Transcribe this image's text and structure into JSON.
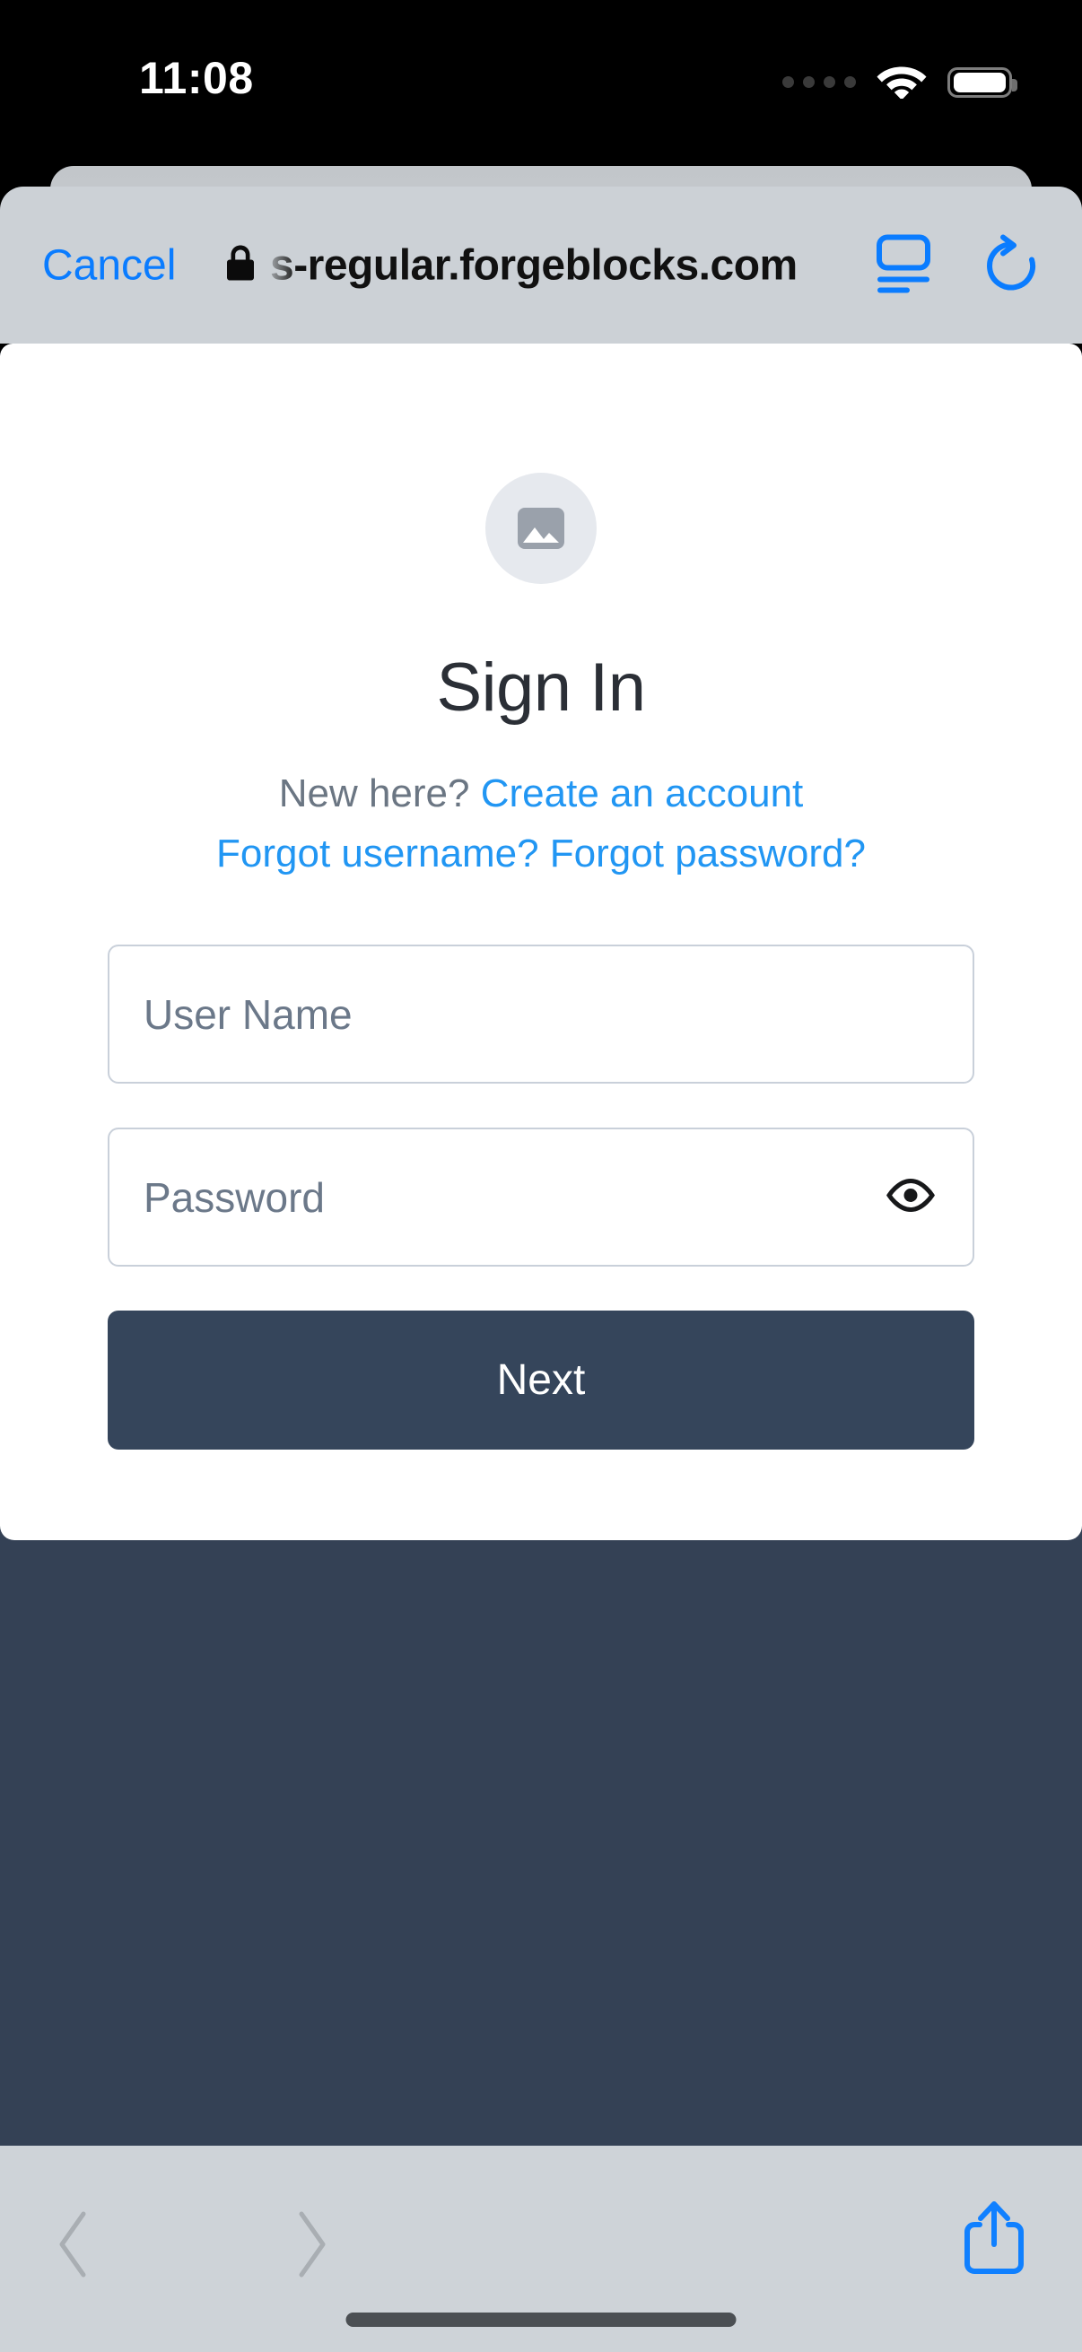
{
  "status_bar": {
    "time": "11:08",
    "signal_icon": "signal-dots-icon",
    "wifi_icon": "wifi-icon",
    "battery_icon": "battery-full-icon"
  },
  "browser": {
    "name": "safari-mobile",
    "toolbar": {
      "cancel_label": "Cancel",
      "lock_icon": "lock-icon",
      "url": "s-regular.forgeblocks.com",
      "reader_icon": "reader-view-icon",
      "reload_icon": "reload-icon"
    },
    "bottom_bar": {
      "back_icon": "chevron-left-icon",
      "forward_icon": "chevron-right-icon",
      "share_icon": "share-icon",
      "home_indicator": "home-indicator"
    }
  },
  "page": {
    "logo_icon": "image-placeholder-icon",
    "title": "Sign In",
    "signup_prompt": "New here?",
    "signup_link": "Create an account",
    "forgot_username_link": "Forgot username?",
    "forgot_password_link": "Forgot password?",
    "fields": [
      {
        "name": "username",
        "placeholder": "User Name",
        "value": ""
      },
      {
        "name": "password",
        "placeholder": "Password",
        "value": ""
      }
    ],
    "password_toggle_icon": "eye-icon",
    "submit_label": "Next"
  },
  "colors": {
    "accent_link": "#2196f3",
    "ios_blue": "#0a7cff",
    "page_background": "#344155",
    "button_background": "#35455b",
    "field_border": "#c9d0da",
    "placeholder_text": "#6b7889",
    "toolbar_background": "#ccd1d6"
  }
}
